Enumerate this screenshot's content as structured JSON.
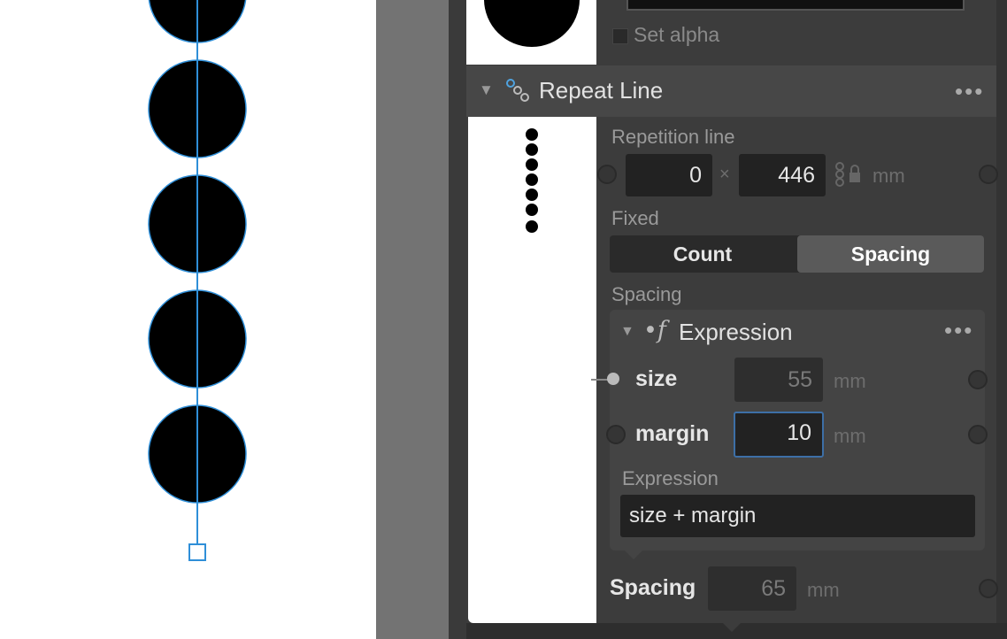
{
  "top_node": {
    "checkbox_label": "Set alpha",
    "checkbox_checked": false
  },
  "repeat_line": {
    "title": "Repeat Line",
    "icon": "chain-link-icon",
    "repetition_label": "Repetition line",
    "x_value": "0",
    "separator": "×",
    "y_value": "446",
    "unit": "mm",
    "fixed_label": "Fixed",
    "fixed_options": [
      "Count",
      "Spacing"
    ],
    "fixed_selected": "Spacing",
    "spacing_section_label": "Spacing",
    "spacing_label": "Spacing",
    "spacing_value": "65",
    "spacing_unit": "mm"
  },
  "expression_node": {
    "title": "Expression",
    "icon": "function-icon",
    "params": [
      {
        "name": "size",
        "value": "55",
        "unit": "mm",
        "connected": true
      },
      {
        "name": "margin",
        "value": "10",
        "unit": "mm",
        "connected": false
      }
    ],
    "expression_label": "Expression",
    "expression_value": "size + margin"
  },
  "canvas": {
    "circle_count": 5,
    "preview_dot_count": 7
  },
  "colors": {
    "guide": "#2f8fd8",
    "panel_bg": "#3c3c3c",
    "header_bg": "#474747",
    "field_bg": "#222222",
    "active_segment": "#5a5a5a"
  }
}
